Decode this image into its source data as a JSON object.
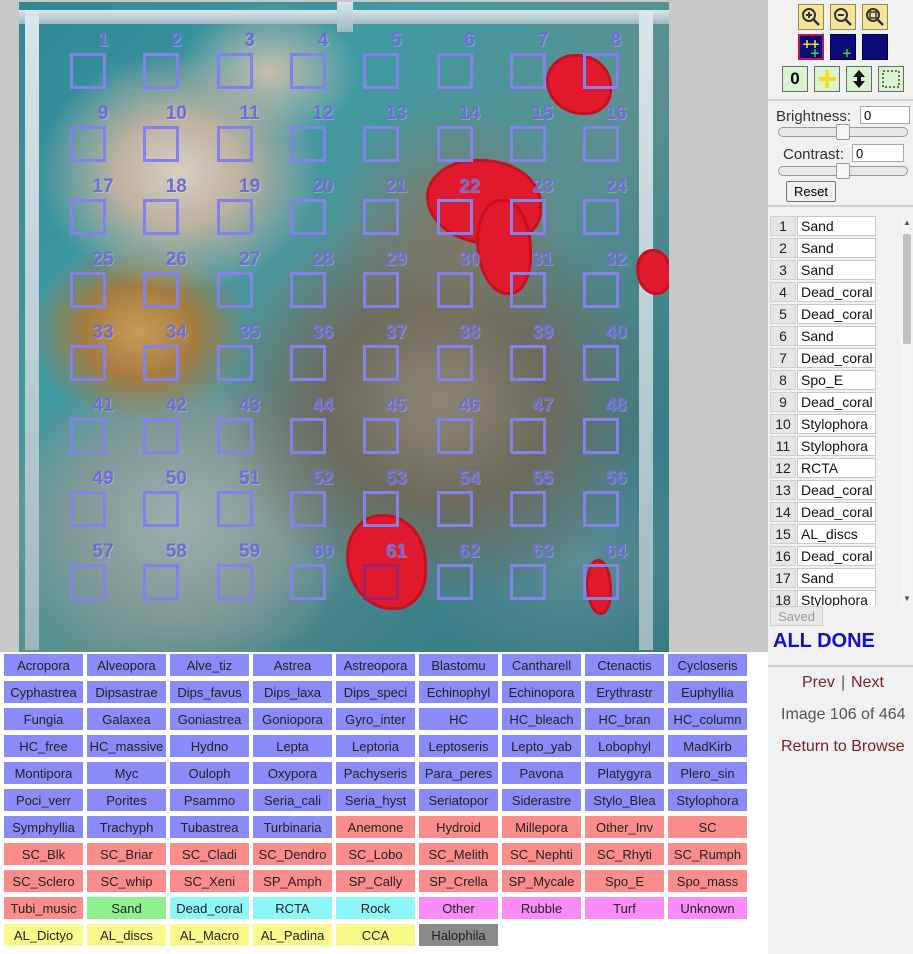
{
  "viewer": {
    "grid_points": [
      "1",
      "2",
      "3",
      "4",
      "5",
      "6",
      "7",
      "8",
      "9",
      "10",
      "11",
      "12",
      "13",
      "14",
      "15",
      "16",
      "17",
      "18",
      "19",
      "20",
      "21",
      "22",
      "23",
      "24",
      "25",
      "26",
      "27",
      "28",
      "29",
      "30",
      "31",
      "32",
      "33",
      "34",
      "35",
      "36",
      "37",
      "38",
      "39",
      "40",
      "41",
      "42",
      "43",
      "44",
      "45",
      "46",
      "47",
      "48",
      "49",
      "50",
      "51",
      "52",
      "53",
      "54",
      "55",
      "56",
      "57",
      "58",
      "59",
      "60",
      "61",
      "62",
      "63",
      "64"
    ],
    "current_point": "61"
  },
  "toolbar": {
    "counter_label": "0",
    "icons": [
      "zoom-in-icon",
      "zoom-out-icon",
      "zoom-fit-icon",
      "add-points-icon",
      "add-point-icon",
      "blank-icon",
      "counter-icon",
      "plus-icon",
      "move-updown-icon",
      "select-box-icon"
    ]
  },
  "adjust": {
    "brightness_label": "Brightness:",
    "brightness_value": "0",
    "contrast_label": "Contrast:",
    "contrast_value": "0",
    "reset_label": "Reset"
  },
  "points": [
    {
      "num": "1",
      "label": "Sand"
    },
    {
      "num": "2",
      "label": "Sand"
    },
    {
      "num": "3",
      "label": "Sand"
    },
    {
      "num": "4",
      "label": "Dead_coral"
    },
    {
      "num": "5",
      "label": "Dead_coral"
    },
    {
      "num": "6",
      "label": "Sand"
    },
    {
      "num": "7",
      "label": "Dead_coral"
    },
    {
      "num": "8",
      "label": "Spo_E"
    },
    {
      "num": "9",
      "label": "Dead_coral"
    },
    {
      "num": "10",
      "label": "Stylophora"
    },
    {
      "num": "11",
      "label": "Stylophora"
    },
    {
      "num": "12",
      "label": "RCTA"
    },
    {
      "num": "13",
      "label": "Dead_coral"
    },
    {
      "num": "14",
      "label": "Dead_coral"
    },
    {
      "num": "15",
      "label": "AL_discs"
    },
    {
      "num": "16",
      "label": "Dead_coral"
    },
    {
      "num": "17",
      "label": "Sand"
    },
    {
      "num": "18",
      "label": "Stylophora"
    }
  ],
  "status": {
    "saved_label": "Saved",
    "all_done": "ALL DONE",
    "prev": "Prev",
    "sep": "|",
    "next": "Next",
    "image_counter": "Image 106 of 464",
    "return": "Return to Browse"
  },
  "colors": {
    "hard_coral": "#8a8af8",
    "soft_coral": "#fa8c8c",
    "sand": "#90f090",
    "dead_coral": "#8cf8f8",
    "other": "#fa8cfa",
    "algae": "#fafa8c",
    "seagrass": "#8a8a8a"
  },
  "categories": [
    {
      "label": "Acropora",
      "group": "hard_coral"
    },
    {
      "label": "Alveopora",
      "group": "hard_coral"
    },
    {
      "label": "Alve_tiz",
      "group": "hard_coral"
    },
    {
      "label": "Astrea",
      "group": "hard_coral"
    },
    {
      "label": "Astreopora",
      "group": "hard_coral"
    },
    {
      "label": "Blastomu",
      "group": "hard_coral"
    },
    {
      "label": "Cantharell",
      "group": "hard_coral"
    },
    {
      "label": "Ctenactis",
      "group": "hard_coral"
    },
    {
      "label": "Cycloseris",
      "group": "hard_coral"
    },
    {
      "label": "Cyphastrea",
      "group": "hard_coral"
    },
    {
      "label": "Dipsastrae",
      "group": "hard_coral"
    },
    {
      "label": "Dips_favus",
      "group": "hard_coral"
    },
    {
      "label": "Dips_laxa",
      "group": "hard_coral"
    },
    {
      "label": "Dips_speci",
      "group": "hard_coral"
    },
    {
      "label": "Echinophyl",
      "group": "hard_coral"
    },
    {
      "label": "Echinopora",
      "group": "hard_coral"
    },
    {
      "label": "Erythrastr",
      "group": "hard_coral"
    },
    {
      "label": "Euphyllia",
      "group": "hard_coral"
    },
    {
      "label": "Fungia",
      "group": "hard_coral"
    },
    {
      "label": "Galaxea",
      "group": "hard_coral"
    },
    {
      "label": "Goniastrea",
      "group": "hard_coral"
    },
    {
      "label": "Goniopora",
      "group": "hard_coral"
    },
    {
      "label": "Gyro_inter",
      "group": "hard_coral"
    },
    {
      "label": "HC",
      "group": "hard_coral"
    },
    {
      "label": "HC_bleach",
      "group": "hard_coral"
    },
    {
      "label": "HC_bran",
      "group": "hard_coral"
    },
    {
      "label": "HC_column",
      "group": "hard_coral"
    },
    {
      "label": "HC_free",
      "group": "hard_coral"
    },
    {
      "label": "HC_massive",
      "group": "hard_coral"
    },
    {
      "label": "Hydno",
      "group": "hard_coral"
    },
    {
      "label": "Lepta",
      "group": "hard_coral"
    },
    {
      "label": "Leptoria",
      "group": "hard_coral"
    },
    {
      "label": "Leptoseris",
      "group": "hard_coral"
    },
    {
      "label": "Lepto_yab",
      "group": "hard_coral"
    },
    {
      "label": "Lobophyl",
      "group": "hard_coral"
    },
    {
      "label": "MadKirb",
      "group": "hard_coral"
    },
    {
      "label": "Montipora",
      "group": "hard_coral"
    },
    {
      "label": "Myc",
      "group": "hard_coral"
    },
    {
      "label": "Ouloph",
      "group": "hard_coral"
    },
    {
      "label": "Oxypora",
      "group": "hard_coral"
    },
    {
      "label": "Pachyseris",
      "group": "hard_coral"
    },
    {
      "label": "Para_peres",
      "group": "hard_coral"
    },
    {
      "label": "Pavona",
      "group": "hard_coral"
    },
    {
      "label": "Platygyra",
      "group": "hard_coral"
    },
    {
      "label": "Plero_sin",
      "group": "hard_coral"
    },
    {
      "label": "Poci_verr",
      "group": "hard_coral"
    },
    {
      "label": "Porites",
      "group": "hard_coral"
    },
    {
      "label": "Psammo",
      "group": "hard_coral"
    },
    {
      "label": "Seria_cali",
      "group": "hard_coral"
    },
    {
      "label": "Seria_hyst",
      "group": "hard_coral"
    },
    {
      "label": "Seriatopor",
      "group": "hard_coral"
    },
    {
      "label": "Siderastre",
      "group": "hard_coral"
    },
    {
      "label": "Stylo_Blea",
      "group": "hard_coral"
    },
    {
      "label": "Stylophora",
      "group": "hard_coral"
    },
    {
      "label": "Symphyllia",
      "group": "hard_coral"
    },
    {
      "label": "Trachyph",
      "group": "hard_coral"
    },
    {
      "label": "Tubastrea",
      "group": "hard_coral"
    },
    {
      "label": "Turbinaria",
      "group": "hard_coral"
    },
    {
      "label": "Anemone",
      "group": "soft_coral"
    },
    {
      "label": "Hydroid",
      "group": "soft_coral"
    },
    {
      "label": "Millepora",
      "group": "soft_coral"
    },
    {
      "label": "Other_Inv",
      "group": "soft_coral"
    },
    {
      "label": "SC",
      "group": "soft_coral"
    },
    {
      "label": "SC_Blk",
      "group": "soft_coral"
    },
    {
      "label": "SC_Briar",
      "group": "soft_coral"
    },
    {
      "label": "SC_Cladi",
      "group": "soft_coral"
    },
    {
      "label": "SC_Dendro",
      "group": "soft_coral"
    },
    {
      "label": "SC_Lobo",
      "group": "soft_coral"
    },
    {
      "label": "SC_Melith",
      "group": "soft_coral"
    },
    {
      "label": "SC_Nephti",
      "group": "soft_coral"
    },
    {
      "label": "SC_Rhyti",
      "group": "soft_coral"
    },
    {
      "label": "SC_Rumph",
      "group": "soft_coral"
    },
    {
      "label": "SC_Sclero",
      "group": "soft_coral"
    },
    {
      "label": "SC_whip",
      "group": "soft_coral"
    },
    {
      "label": "SC_Xeni",
      "group": "soft_coral"
    },
    {
      "label": "SP_Amph",
      "group": "soft_coral"
    },
    {
      "label": "SP_Cally",
      "group": "soft_coral"
    },
    {
      "label": "SP_Crella",
      "group": "soft_coral"
    },
    {
      "label": "SP_Mycale",
      "group": "soft_coral"
    },
    {
      "label": "Spo_E",
      "group": "soft_coral"
    },
    {
      "label": "Spo_mass",
      "group": "soft_coral"
    },
    {
      "label": "Tubi_music",
      "group": "soft_coral"
    },
    {
      "label": "Sand",
      "group": "sand"
    },
    {
      "label": "Dead_coral",
      "group": "dead_coral"
    },
    {
      "label": "RCTA",
      "group": "dead_coral"
    },
    {
      "label": "Rock",
      "group": "dead_coral"
    },
    {
      "label": "Other",
      "group": "other"
    },
    {
      "label": "Rubble",
      "group": "other"
    },
    {
      "label": "Turf",
      "group": "other"
    },
    {
      "label": "Unknown",
      "group": "other"
    },
    {
      "label": "AL_Dictyo",
      "group": "algae"
    },
    {
      "label": "AL_discs",
      "group": "algae"
    },
    {
      "label": "AL_Macro",
      "group": "algae"
    },
    {
      "label": "AL_Padina",
      "group": "algae"
    },
    {
      "label": "CCA",
      "group": "algae"
    },
    {
      "label": "Halophila",
      "group": "seagrass"
    }
  ]
}
